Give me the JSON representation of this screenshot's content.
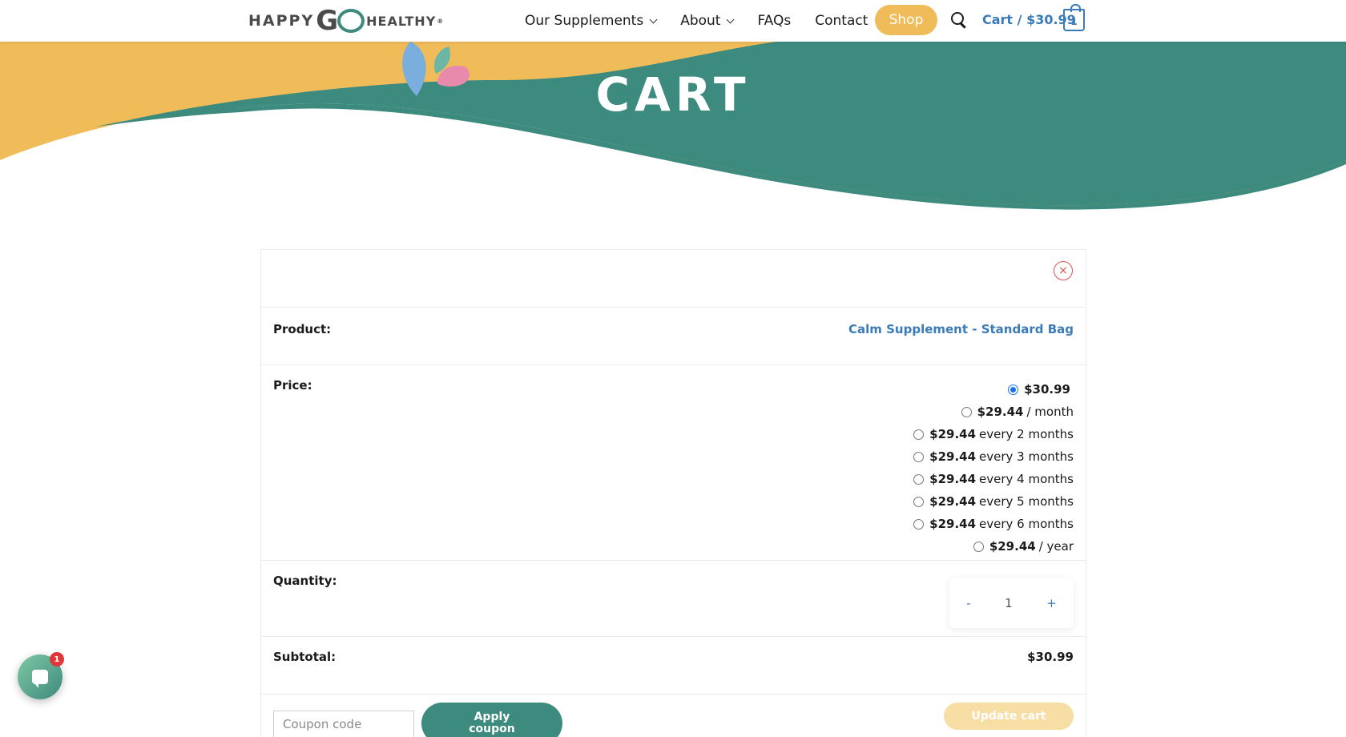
{
  "header": {
    "logo": {
      "part1": "HAPPY",
      "part2": "G",
      "part3": "HEALTHY",
      "reg": "®"
    },
    "nav": [
      {
        "label": "Our Supplements",
        "dropdown": true
      },
      {
        "label": "About",
        "dropdown": true
      },
      {
        "label": "FAQs",
        "dropdown": false
      },
      {
        "label": "Contact",
        "dropdown": false
      }
    ],
    "shop_label": "Shop",
    "cart_label": "Cart / $30.99",
    "cart_count": "1"
  },
  "hero": {
    "title": "CART"
  },
  "cart": {
    "remove_symbol": "×",
    "product_label": "Product:",
    "product_name": "Calm Supplement - Standard Bag",
    "price_label": "Price:",
    "price_options": [
      {
        "amount": "$30.99",
        "suffix": "",
        "checked": true
      },
      {
        "amount": "$29.44",
        "suffix": "/ month",
        "checked": false
      },
      {
        "amount": "$29.44",
        "suffix": "every 2 months",
        "checked": false
      },
      {
        "amount": "$29.44",
        "suffix": "every 3 months",
        "checked": false
      },
      {
        "amount": "$29.44",
        "suffix": "every 4 months",
        "checked": false
      },
      {
        "amount": "$29.44",
        "suffix": "every 5 months",
        "checked": false
      },
      {
        "amount": "$29.44",
        "suffix": "every 6 months",
        "checked": false
      },
      {
        "amount": "$29.44",
        "suffix": "/ year",
        "checked": false
      }
    ],
    "quantity_label": "Quantity:",
    "qty_minus": "-",
    "qty_value": "1",
    "qty_plus": "+",
    "subtotal_label": "Subtotal:",
    "subtotal_value": "$30.99",
    "coupon_placeholder": "Coupon code",
    "apply_label": "Apply coupon",
    "update_label": "Update cart"
  },
  "chat": {
    "badge": "1"
  },
  "colors": {
    "teal": "#3d8a7e",
    "yellow": "#f0bb59",
    "link_blue": "#3a7bb8",
    "remove_red": "#d9534f"
  }
}
